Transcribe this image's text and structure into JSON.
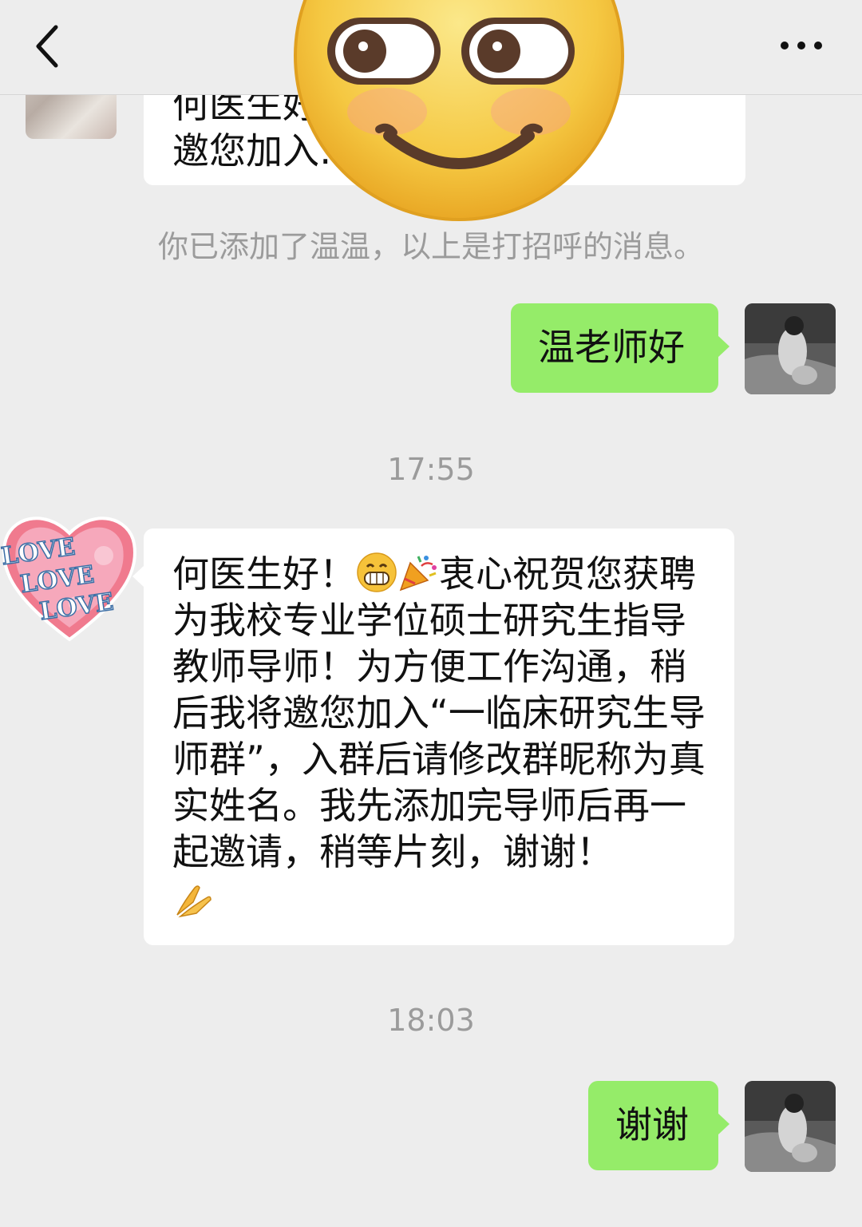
{
  "header": {
    "back_icon": "chevron-left-icon",
    "more_icon": "more-dots-icon"
  },
  "messages": {
    "top_partial": {
      "line1": "何医生好，…… 工，诚",
      "line2": "邀您加入……"
    },
    "system_note": "你已添加了温温，以上是打招呼的消息。",
    "greeting_sent": "温老师好",
    "time1": "17:55",
    "long_message": {
      "greeting": "何医生好！",
      "body": "衷心祝贺您获聘为我校专业学位硕士研究生指导教师导师！为方便工作沟通，稍后我将邀您加入“一临床研究生导师群”，入群后请修改群昵称为真实姓名。我先添加完导师后再一起邀请，稍等片刻，谢谢！",
      "emojis": [
        "grinning-face-icon",
        "party-popper-icon",
        "folded-hands-icon"
      ]
    },
    "time2": "18:03",
    "thanks_sent": "谢谢"
  },
  "stickers": {
    "big_emoji": "smirk-face-sticker",
    "sender_avatar": "love-heart-avatar",
    "heart_text": [
      "LOVE",
      "LOVE",
      "LOVE"
    ]
  },
  "colors": {
    "background": "#ededed",
    "sent_bubble": "#95ec69",
    "received_bubble": "#ffffff",
    "system_text": "#9b9b9b"
  }
}
